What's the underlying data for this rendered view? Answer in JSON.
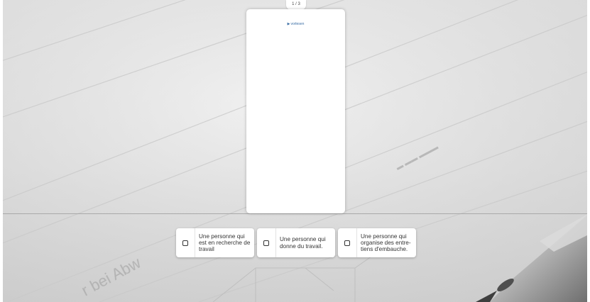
{
  "counter": "1 / 3",
  "card": {
    "listen_label": "vorlesen",
    "listen_icon": "play-icon"
  },
  "options": [
    {
      "label": "Une personne qui\nest en recherche de\ntravail",
      "checked": false
    },
    {
      "label": "Une personne qui\ndonne du travail.",
      "checked": false
    },
    {
      "label": "Une personne qui\norganise des entre-\ntiens d'embauche.",
      "checked": false
    }
  ],
  "colors": {
    "accent": "#3a6ea5",
    "card_bg": "#ffffff",
    "text": "#333333"
  }
}
